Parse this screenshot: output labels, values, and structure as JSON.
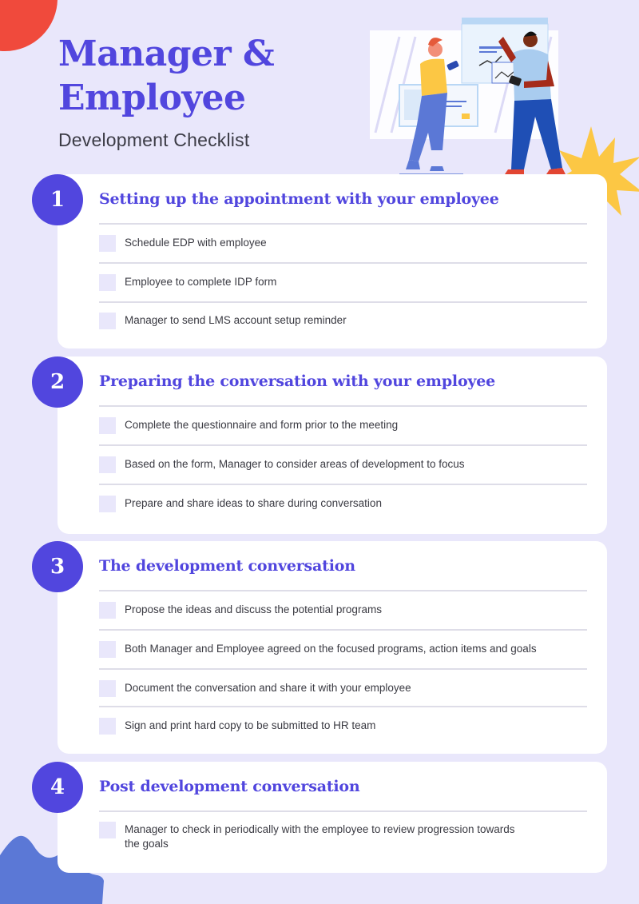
{
  "header": {
    "title_line1": "Manager &",
    "title_line2": "Employee",
    "subtitle": "Development Checklist"
  },
  "colors": {
    "background": "#e9e7fb",
    "accent": "#5146de",
    "card": "#ffffff",
    "checkbox": "#e9e7fb",
    "deco_red": "#f04a3c",
    "deco_yellow": "#fcc744",
    "deco_blue": "#5b78d6"
  },
  "illustration": {
    "description": "two people collaborating over charts and documents"
  },
  "sections": [
    {
      "number": "1",
      "title": "Setting up the appointment with your employee",
      "items": [
        {
          "label": "Schedule EDP with employee",
          "checked": false
        },
        {
          "label": "Employee to complete IDP form",
          "checked": false
        },
        {
          "label": "Manager to send LMS account setup reminder",
          "checked": false
        }
      ]
    },
    {
      "number": "2",
      "title": "Preparing the conversation with your employee",
      "items": [
        {
          "label": "Complete the questionnaire and form prior to the meeting",
          "checked": false
        },
        {
          "label": "Based on the form, Manager to consider areas of development to focus",
          "checked": false
        },
        {
          "label": "Prepare and share ideas to share during conversation",
          "checked": false
        }
      ]
    },
    {
      "number": "3",
      "title": "The development conversation",
      "items": [
        {
          "label": "Propose the ideas and discuss the potential programs",
          "checked": false
        },
        {
          "label": "Both Manager and Employee agreed on the focused programs, action items and goals",
          "checked": false
        },
        {
          "label": "Document the conversation and share it with your employee",
          "checked": false
        },
        {
          "label": "Sign and print hard copy to be submitted to HR team",
          "checked": false
        }
      ]
    },
    {
      "number": "4",
      "title": "Post development conversation",
      "items": [
        {
          "label": "Manager to check in periodically with the employee to review progression towards the goals",
          "checked": false
        }
      ]
    }
  ]
}
